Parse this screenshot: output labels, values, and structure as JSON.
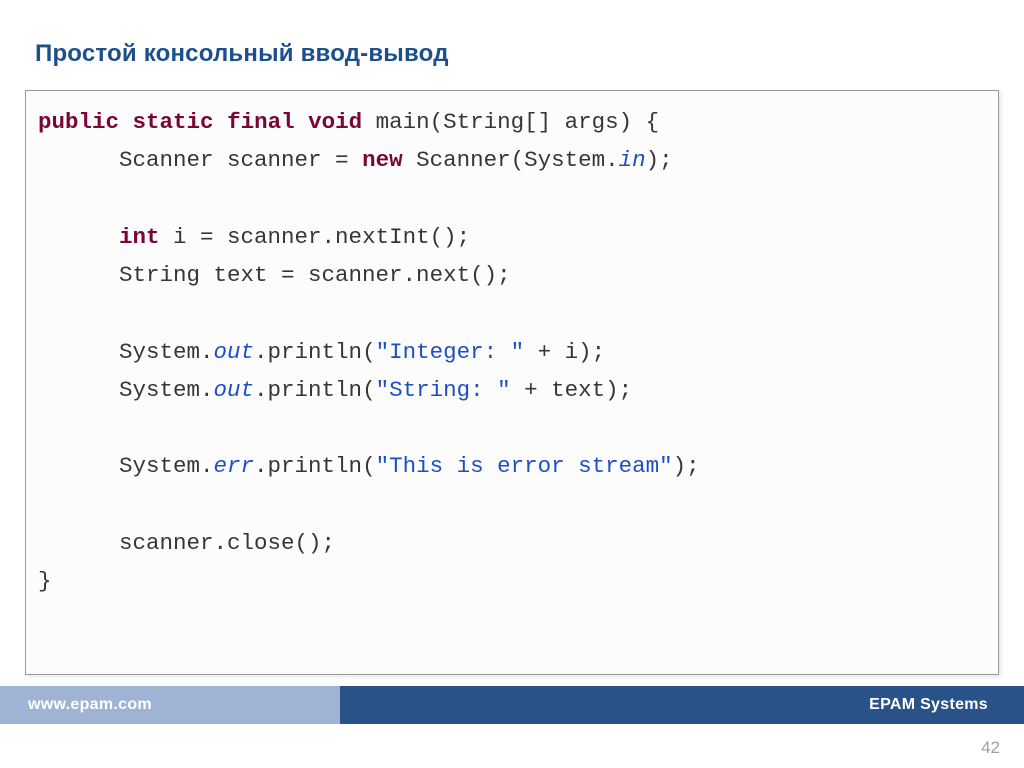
{
  "title": "Простой консольный ввод-вывод",
  "code": {
    "l1": {
      "kw1": "public",
      "kw2": "static",
      "kw3": "final",
      "kw4": "void",
      "rest": " main(String[] args) {"
    },
    "l2": {
      "pre": "      Scanner scanner = ",
      "kw": "new",
      "mid": " Scanner(System.",
      "field": "in",
      "post": ");"
    },
    "l4": {
      "indent": "      ",
      "kw": "int",
      "rest": " i = scanner.nextInt();"
    },
    "l5": "      String text = scanner.next();",
    "l7": {
      "pre": "      System.",
      "field": "out",
      "mid": ".println(",
      "str": "\"Integer: \"",
      "post": " + i);"
    },
    "l8": {
      "pre": "      System.",
      "field": "out",
      "mid": ".println(",
      "str": "\"String: \"",
      "post": " + text);"
    },
    "l10": {
      "pre": "      System.",
      "field": "err",
      "mid": ".println(",
      "str": "\"This is error stream\"",
      "post": ");"
    },
    "l12": "      scanner.close();",
    "l13": "}"
  },
  "footer": {
    "left": "www.epam.com",
    "right": "EPAM Systems"
  },
  "page": "42"
}
